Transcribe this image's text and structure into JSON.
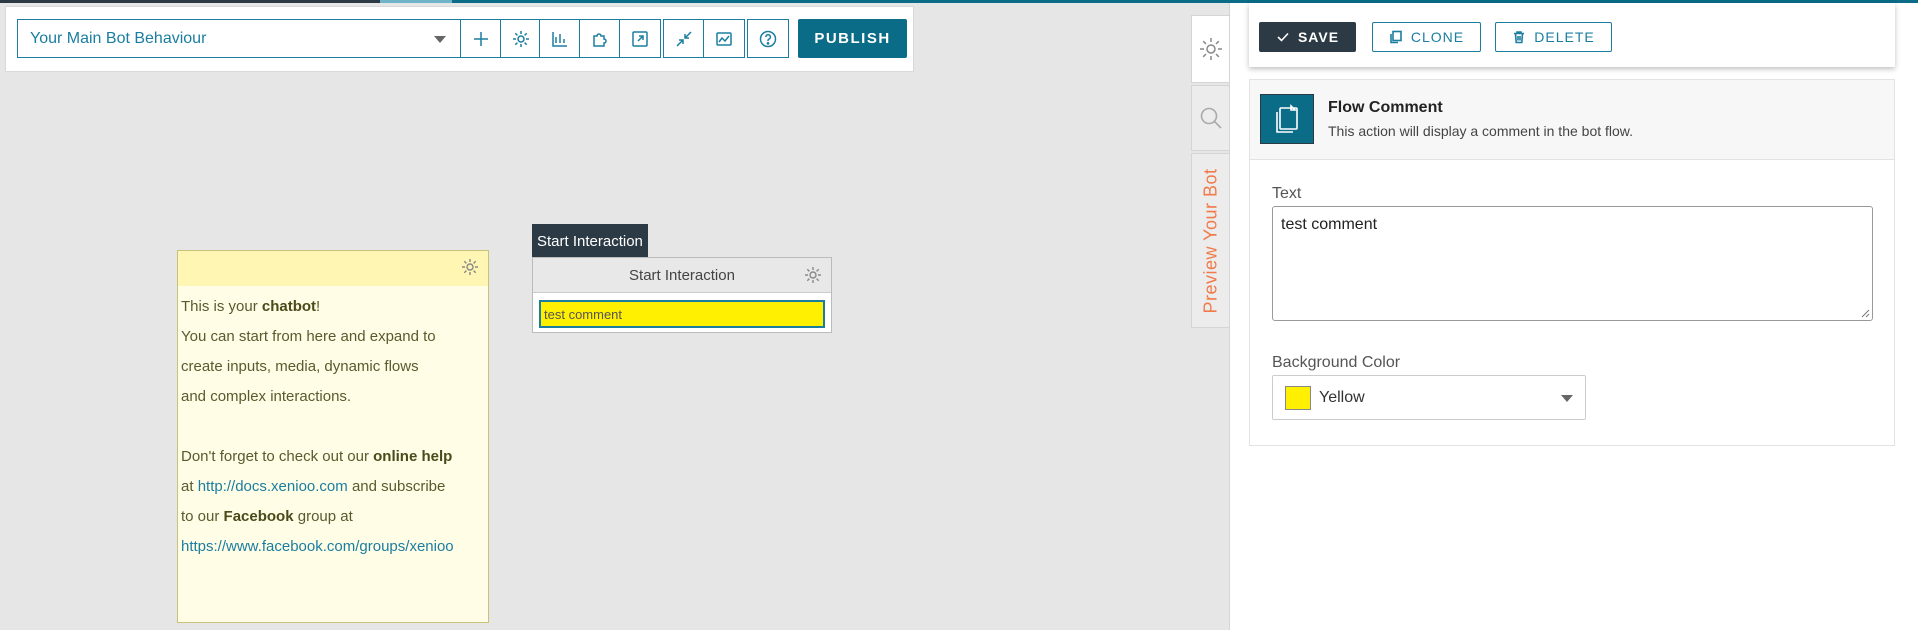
{
  "toolbar": {
    "behaviour_selected": "Your Main Bot Behaviour",
    "publish_label": "PUBLISH",
    "icons": [
      "plus-icon",
      "gear-icon",
      "chart-icon",
      "puzzle-icon",
      "export-icon",
      "collapse-icon",
      "analytics-icon",
      "help-icon"
    ]
  },
  "note": {
    "line1_pre": "This is your ",
    "line1_bold": "chatbot",
    "line1_post": "!",
    "line2": "You can start from here and expand to",
    "line3": "create inputs, media, dynamic flows",
    "line4": "and complex interactions.",
    "line5_pre": "Don't forget to check out our ",
    "line5_bold": "online help",
    "line6_pre": "at ",
    "line6_link": "http://docs.xenioo.com",
    "line6_post": " and subscribe",
    "line7_pre": "to our ",
    "line7_bold": "Facebook",
    "line7_post": " group at",
    "line8_link": "https://www.facebook.com/groups/xenioo"
  },
  "node": {
    "tag": "Start Interaction",
    "title": "Start Interaction",
    "comment": "test comment",
    "comment_color": "#ffef00"
  },
  "side_tabs": {
    "preview_label": "Preview Your Bot"
  },
  "panel": {
    "save_label": "SAVE",
    "clone_label": "CLONE",
    "delete_label": "DELETE",
    "action_title": "Flow Comment",
    "action_desc": "This action will display a comment in the bot flow.",
    "text_label": "Text",
    "text_value": "test comment",
    "bg_label": "Background Color",
    "bg_value": "Yellow",
    "bg_hex": "#ffef00"
  },
  "colors": {
    "accent": "#0a6c87",
    "dark": "#2b3a45",
    "link": "#1b7ea0",
    "preview": "#f07a4a"
  }
}
